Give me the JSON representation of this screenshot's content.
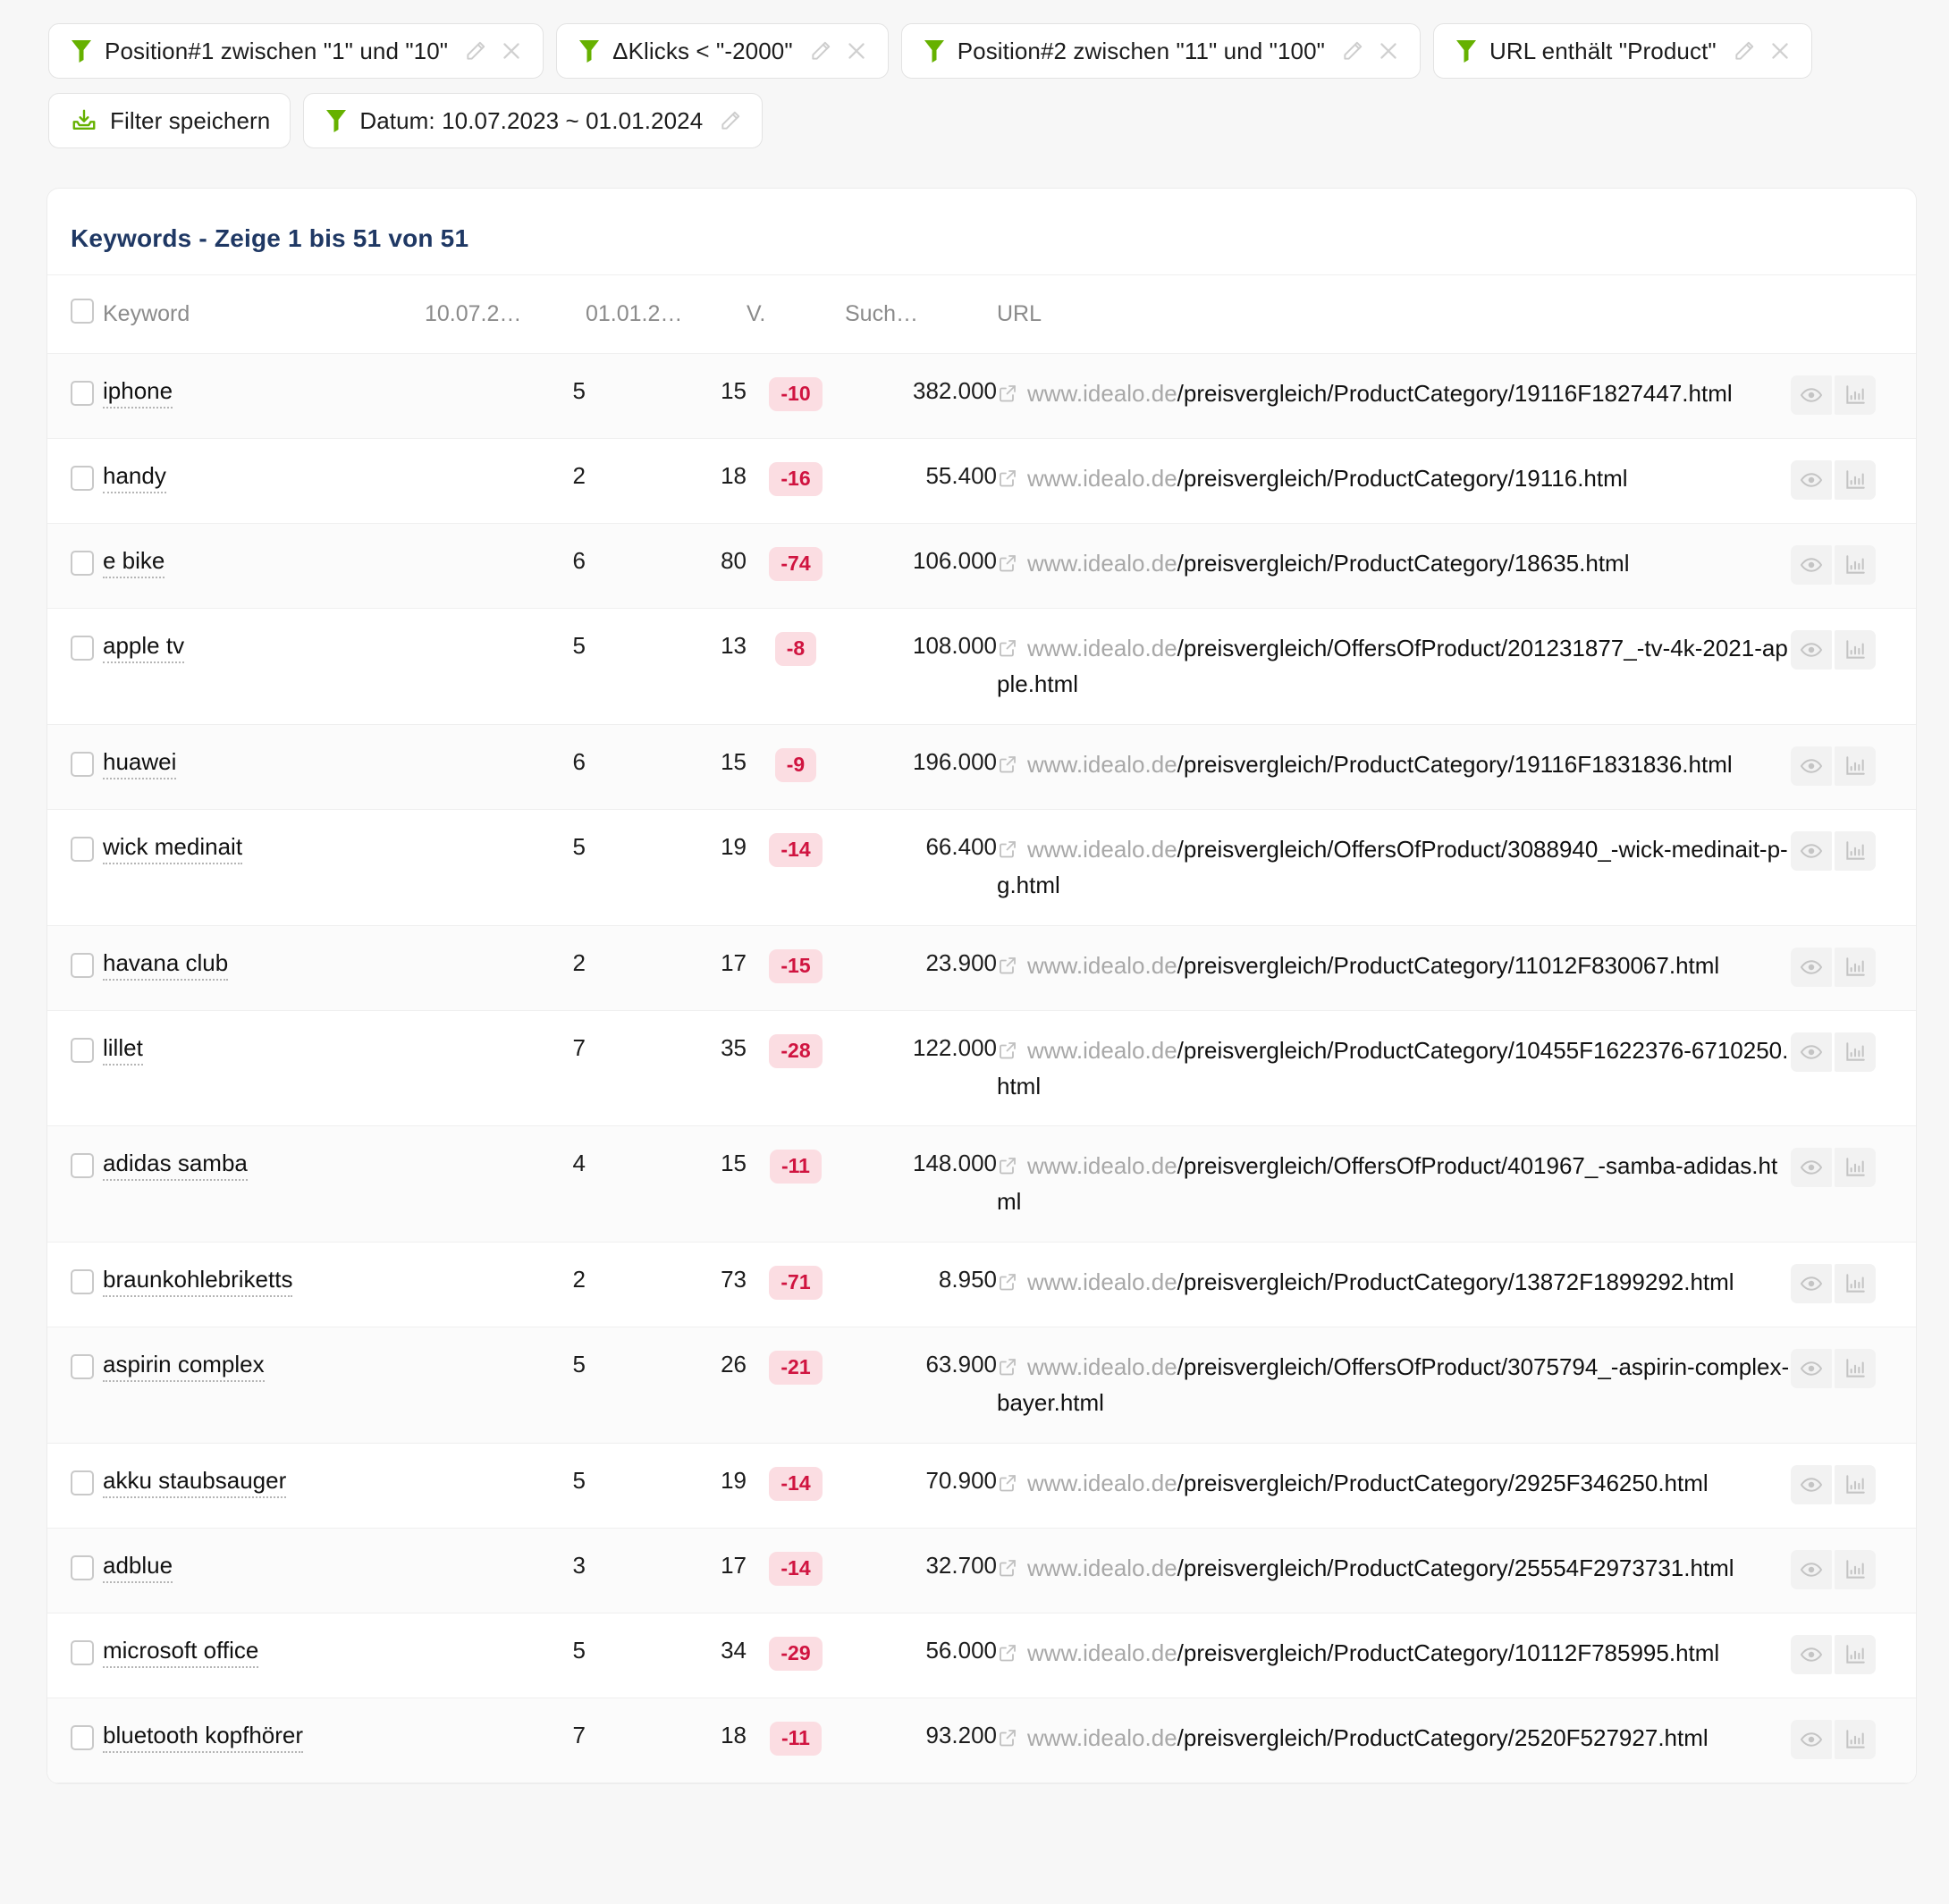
{
  "filters": {
    "chips": [
      {
        "icon": "funnel-icon",
        "label": "Position#1 zwischen \"1\" und \"10\"",
        "edit": true,
        "remove": true
      },
      {
        "icon": "funnel-icon",
        "label": "ΔKlicks < \"-2000\"",
        "edit": true,
        "remove": true
      },
      {
        "icon": "funnel-icon",
        "label": "Position#2 zwischen \"11\" und \"100\"",
        "edit": true,
        "remove": true
      },
      {
        "icon": "funnel-icon",
        "label": "URL enthält \"Product\"",
        "edit": true,
        "remove": true
      },
      {
        "icon": "save-icon",
        "label": "Filter speichern",
        "edit": false,
        "remove": false
      },
      {
        "icon": "funnel-icon",
        "label": "Datum: 10.07.2023 ~ 01.01.2024",
        "edit": true,
        "remove": false
      }
    ],
    "accent_green": "#66b100"
  },
  "card": {
    "title": "Keywords - Zeige 1 bis 51 von 51",
    "title_color": "#1f3864"
  },
  "table": {
    "headers": {
      "select_all": "",
      "keyword": "Keyword",
      "date1": "10.07.2…",
      "date2": "01.01.2…",
      "delta": "V.",
      "volume": "Such…",
      "url": "URL"
    },
    "row_actions": [
      {
        "icon": "eye-icon",
        "name": "preview-button"
      },
      {
        "icon": "bar-chart-icon",
        "name": "chart-button"
      }
    ],
    "delta_badge_bg": "#fbdde2",
    "delta_badge_color": "#d01440",
    "rows": [
      {
        "keyword": "iphone",
        "date1": "5",
        "date2": "15",
        "delta": "-10",
        "volume": "382.000",
        "url_domain": "www.idealo.de",
        "url_path": "/preisvergleich/ProductCategory/19116F1827447.html"
      },
      {
        "keyword": "handy",
        "date1": "2",
        "date2": "18",
        "delta": "-16",
        "volume": "55.400",
        "url_domain": "www.idealo.de",
        "url_path": "/preisvergleich/ProductCategory/19116.html"
      },
      {
        "keyword": "e bike",
        "date1": "6",
        "date2": "80",
        "delta": "-74",
        "volume": "106.000",
        "url_domain": "www.idealo.de",
        "url_path": "/preisvergleich/ProductCategory/18635.html"
      },
      {
        "keyword": "apple tv",
        "date1": "5",
        "date2": "13",
        "delta": "-8",
        "volume": "108.000",
        "url_domain": "www.idealo.de",
        "url_path": "/preisvergleich/OffersOfProduct/201231877_-tv-4k-2021-apple.html"
      },
      {
        "keyword": "huawei",
        "date1": "6",
        "date2": "15",
        "delta": "-9",
        "volume": "196.000",
        "url_domain": "www.idealo.de",
        "url_path": "/preisvergleich/ProductCategory/19116F1831836.html"
      },
      {
        "keyword": "wick medinait",
        "date1": "5",
        "date2": "19",
        "delta": "-14",
        "volume": "66.400",
        "url_domain": "www.idealo.de",
        "url_path": "/preisvergleich/OffersOfProduct/3088940_-wick-medinait-p-g.html"
      },
      {
        "keyword": "havana club",
        "date1": "2",
        "date2": "17",
        "delta": "-15",
        "volume": "23.900",
        "url_domain": "www.idealo.de",
        "url_path": "/preisvergleich/ProductCategory/11012F830067.html"
      },
      {
        "keyword": "lillet",
        "date1": "7",
        "date2": "35",
        "delta": "-28",
        "volume": "122.000",
        "url_domain": "www.idealo.de",
        "url_path": "/preisvergleich/ProductCategory/10455F1622376-6710250.html"
      },
      {
        "keyword": "adidas samba",
        "date1": "4",
        "date2": "15",
        "delta": "-11",
        "volume": "148.000",
        "url_domain": "www.idealo.de",
        "url_path": "/preisvergleich/OffersOfProduct/401967_-samba-adidas.html"
      },
      {
        "keyword": "braunkohlebriketts",
        "date1": "2",
        "date2": "73",
        "delta": "-71",
        "volume": "8.950",
        "url_domain": "www.idealo.de",
        "url_path": "/preisvergleich/ProductCategory/13872F1899292.html"
      },
      {
        "keyword": "aspirin complex",
        "date1": "5",
        "date2": "26",
        "delta": "-21",
        "volume": "63.900",
        "url_domain": "www.idealo.de",
        "url_path": "/preisvergleich/OffersOfProduct/3075794_-aspirin-complex-bayer.html"
      },
      {
        "keyword": "akku staubsauger",
        "date1": "5",
        "date2": "19",
        "delta": "-14",
        "volume": "70.900",
        "url_domain": "www.idealo.de",
        "url_path": "/preisvergleich/ProductCategory/2925F346250.html"
      },
      {
        "keyword": "adblue",
        "date1": "3",
        "date2": "17",
        "delta": "-14",
        "volume": "32.700",
        "url_domain": "www.idealo.de",
        "url_path": "/preisvergleich/ProductCategory/25554F2973731.html"
      },
      {
        "keyword": "microsoft office",
        "date1": "5",
        "date2": "34",
        "delta": "-29",
        "volume": "56.000",
        "url_domain": "www.idealo.de",
        "url_path": "/preisvergleich/ProductCategory/10112F785995.html"
      },
      {
        "keyword": "bluetooth kopfhörer",
        "date1": "7",
        "date2": "18",
        "delta": "-11",
        "volume": "93.200",
        "url_domain": "www.idealo.de",
        "url_path": "/preisvergleich/ProductCategory/2520F527927.html"
      }
    ]
  }
}
